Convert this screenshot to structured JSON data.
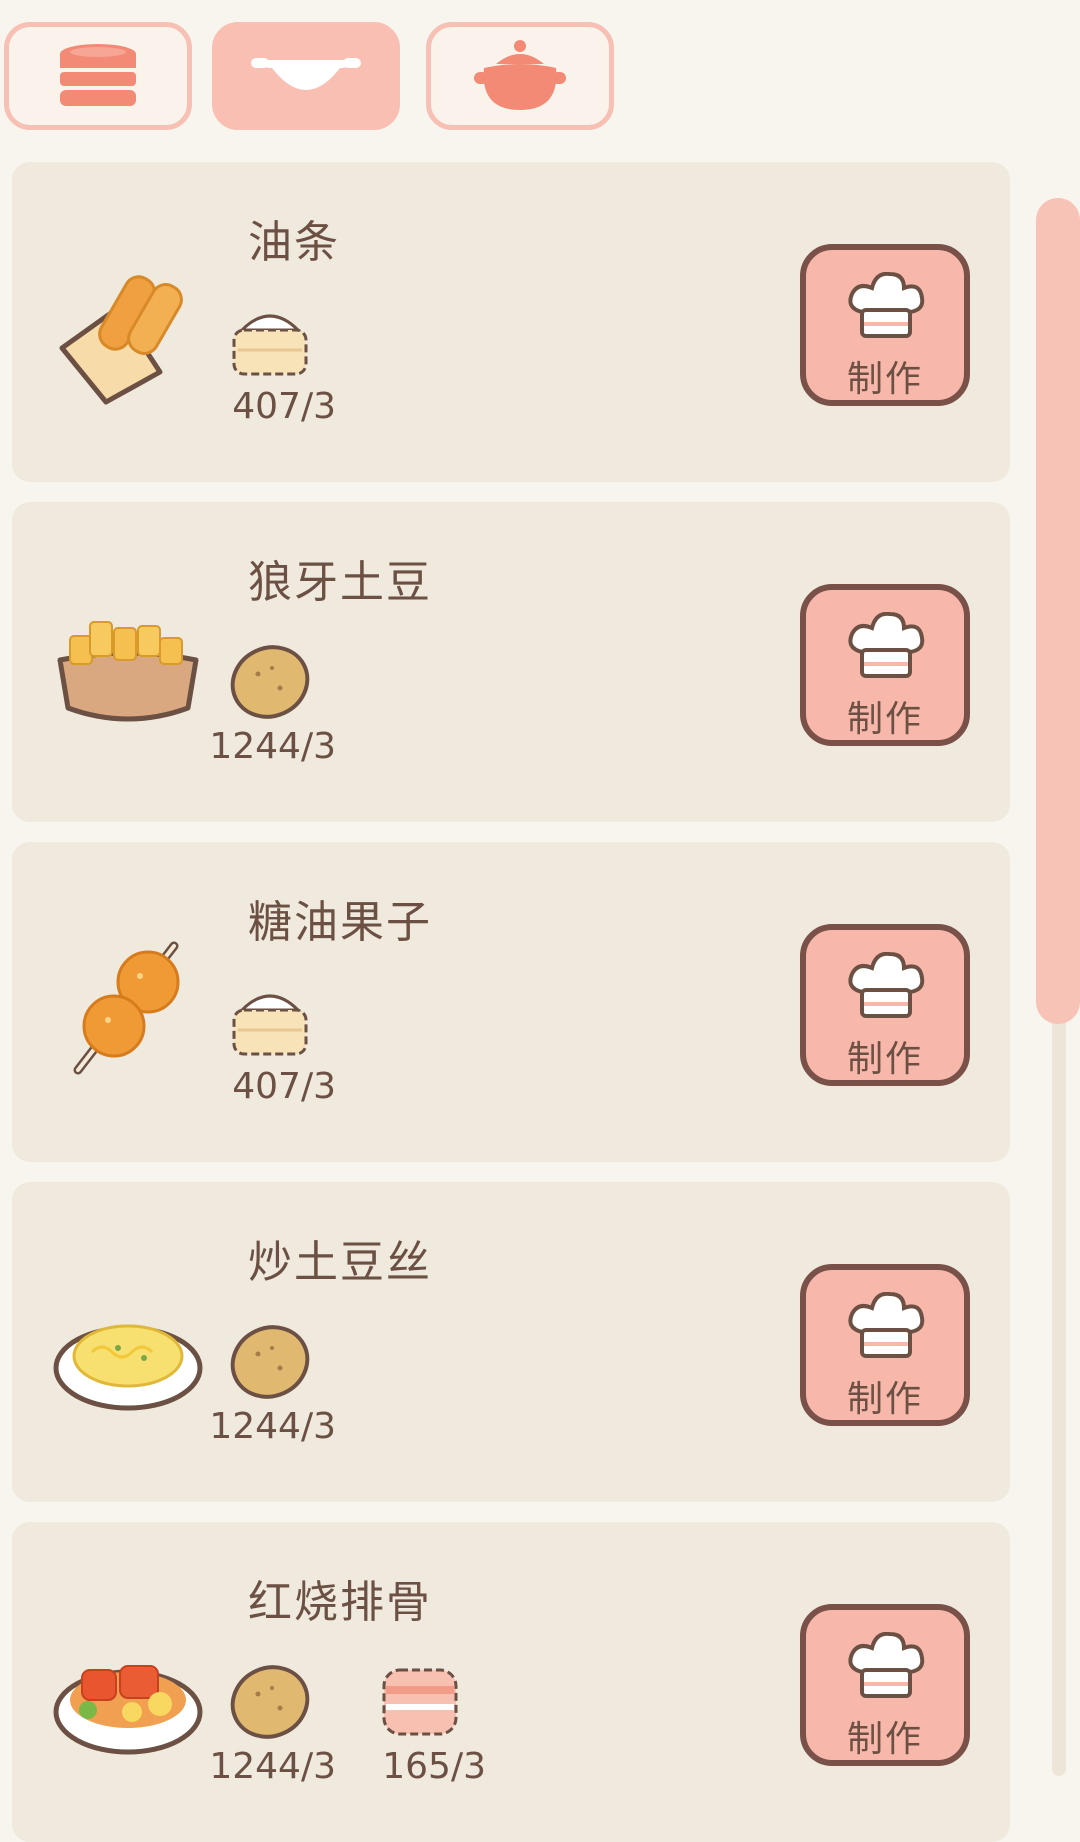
{
  "tabs": [
    {
      "icon": "stacked-dishes-icon",
      "active": false
    },
    {
      "icon": "wok-icon",
      "active": true
    },
    {
      "icon": "clay-pot-icon",
      "active": false
    }
  ],
  "recipes": [
    {
      "name": "油条",
      "image": "youtiao-icon",
      "ingredients": [
        {
          "icon": "flour-bag-icon",
          "count": "407/3"
        }
      ],
      "button": "制作"
    },
    {
      "name": "狼牙土豆",
      "image": "fried-potato-basket-icon",
      "ingredients": [
        {
          "icon": "potato-icon",
          "count": "1244/3"
        }
      ],
      "button": "制作"
    },
    {
      "name": "糖油果子",
      "image": "sugar-dough-skewer-icon",
      "ingredients": [
        {
          "icon": "flour-bag-icon",
          "count": "407/3"
        }
      ],
      "button": "制作"
    },
    {
      "name": "炒土豆丝",
      "image": "shredded-potato-plate-icon",
      "ingredients": [
        {
          "icon": "potato-icon",
          "count": "1244/3"
        }
      ],
      "button": "制作"
    },
    {
      "name": "红烧排骨",
      "image": "braised-ribs-plate-icon",
      "ingredients": [
        {
          "icon": "potato-icon",
          "count": "1244/3"
        },
        {
          "icon": "pork-icon",
          "count": "165/3"
        }
      ],
      "button": "制作"
    }
  ],
  "colors": {
    "accent": "#f7b8ab",
    "card": "#efe9de",
    "text": "#6b5043",
    "border": "#7a5148"
  }
}
